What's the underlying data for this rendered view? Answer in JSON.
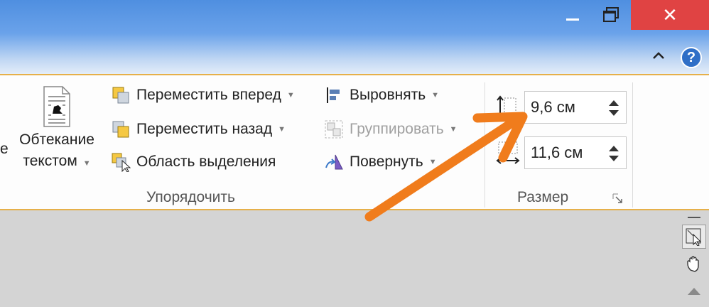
{
  "window": {
    "minimize_label": "—",
    "close_label": "✕",
    "help_label": "?",
    "collapse_label": "︿"
  },
  "arrange": {
    "wrap_text": {
      "line1": "Обтекание",
      "line2": "текстом"
    },
    "left_partial": "е",
    "items": [
      {
        "label": "Переместить вперед",
        "icon": "bring-forward-icon"
      },
      {
        "label": "Переместить назад",
        "icon": "send-backward-icon"
      },
      {
        "label": "Область выделения",
        "icon": "selection-pane-icon"
      },
      {
        "label": "Выровнять",
        "icon": "align-icon"
      },
      {
        "label": "Группировать",
        "icon": "group-icon",
        "disabled": true
      },
      {
        "label": "Повернуть",
        "icon": "rotate-icon"
      }
    ],
    "group_label": "Упорядочить"
  },
  "size": {
    "height_value": "9,6 см",
    "width_value": "11,6 см",
    "group_label": "Размер"
  },
  "colors": {
    "accent_border": "#e6b04a",
    "close_red": "#e04343",
    "arrow_orange": "#f07c1c",
    "titlebar_blue": "#4f8fe0"
  }
}
